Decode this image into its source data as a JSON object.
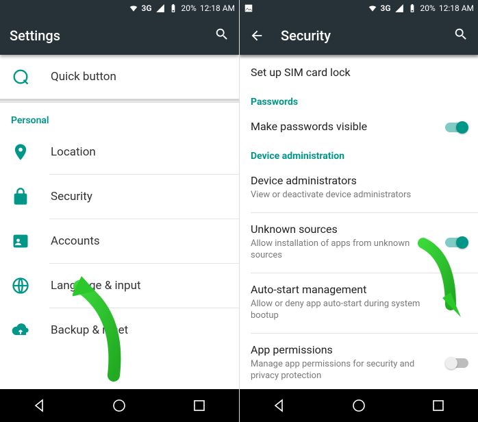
{
  "statusbar": {
    "network": "3G",
    "signal": "▲",
    "battery": "20%",
    "time": "12:18 AM"
  },
  "left": {
    "title": "Settings",
    "quick": "Quick button",
    "category": "Personal",
    "items": [
      {
        "label": "Location",
        "icon": "location"
      },
      {
        "label": "Security",
        "icon": "lock"
      },
      {
        "label": "Accounts",
        "icon": "account"
      },
      {
        "label": "Language & input",
        "icon": "globe"
      },
      {
        "label": "Backup & reset",
        "icon": "cloud"
      }
    ]
  },
  "right": {
    "title": "Security",
    "sim_setup": "Set up SIM card lock",
    "cat_passwords": "Passwords",
    "pw_visible": "Make passwords visible",
    "cat_device": "Device administration",
    "dev_admin_t": "Device administrators",
    "dev_admin_s": "View or deactivate device administrators",
    "unknown_t": "Unknown sources",
    "unknown_s": "Allow installation of apps from unknown sources",
    "auto_t": "Auto-start management",
    "auto_s": "Allow or deny app auto-start during system bootup",
    "perm_t": "App permissions",
    "perm_s": "Manage app permissions for security and privacy protection"
  }
}
